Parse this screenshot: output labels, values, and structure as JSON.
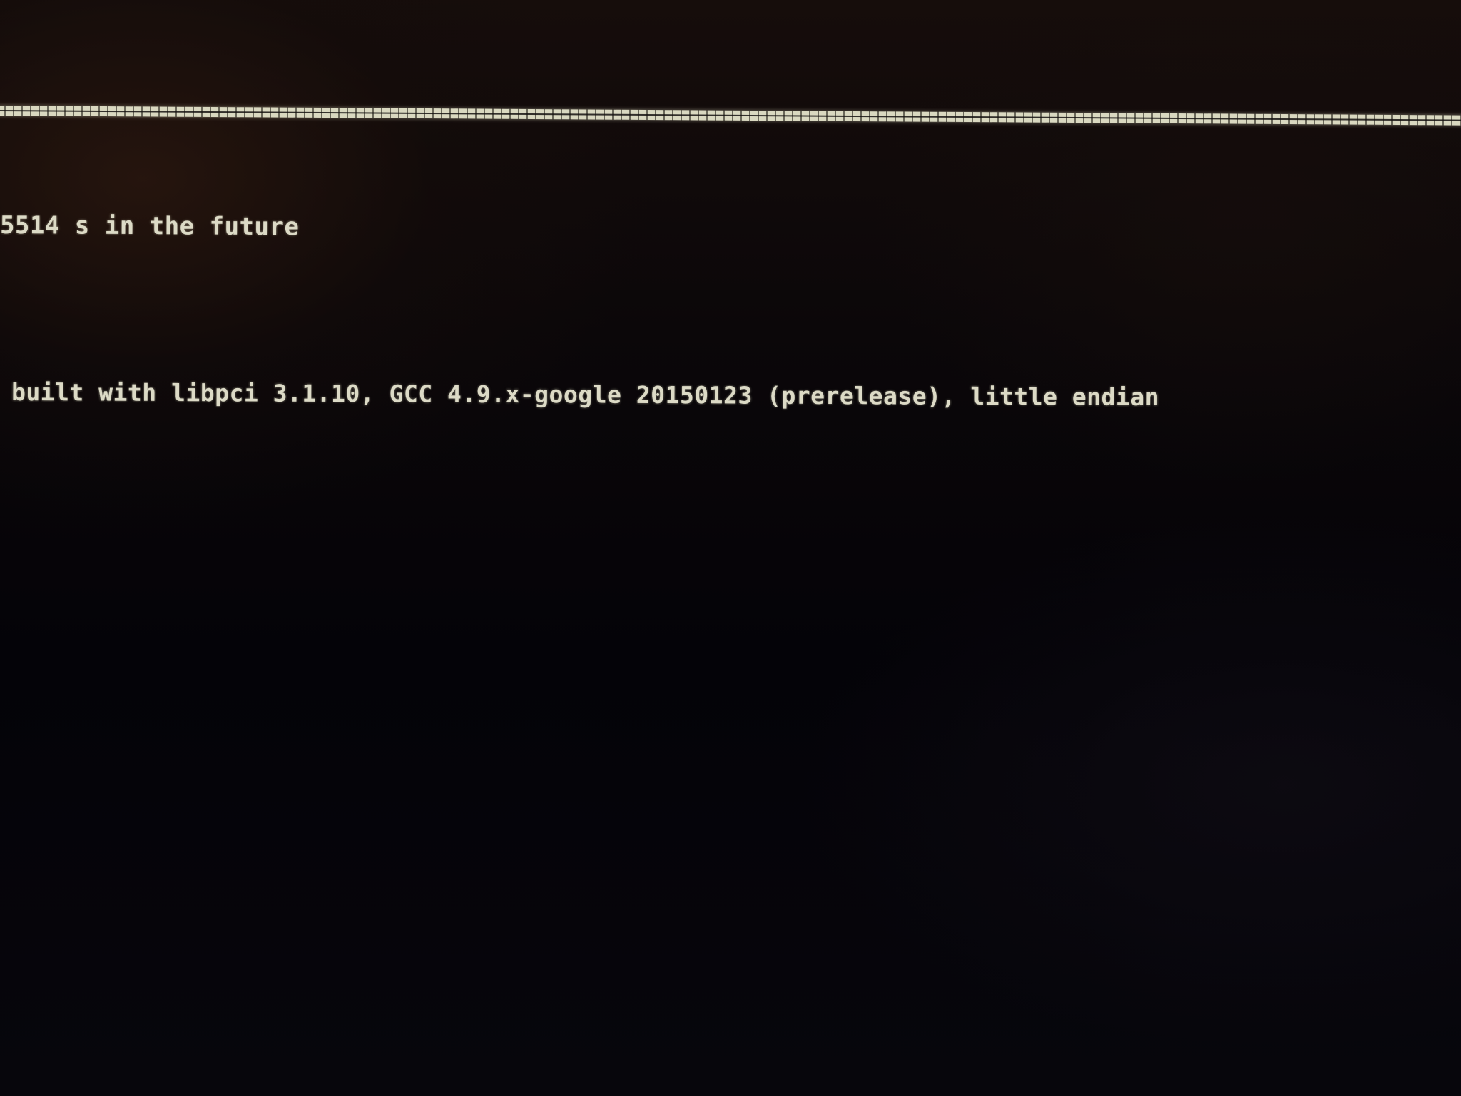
{
  "console": {
    "separator_glyphs": "================================================================================================================================================================",
    "lines": [
      "5514 s in the future",
      "built with libpci 3.1.10, GCC 4.9.x-google 20150123 (prerelease), little endian"
    ]
  },
  "colors": {
    "background": "#050409",
    "text": "#dcdac6"
  }
}
